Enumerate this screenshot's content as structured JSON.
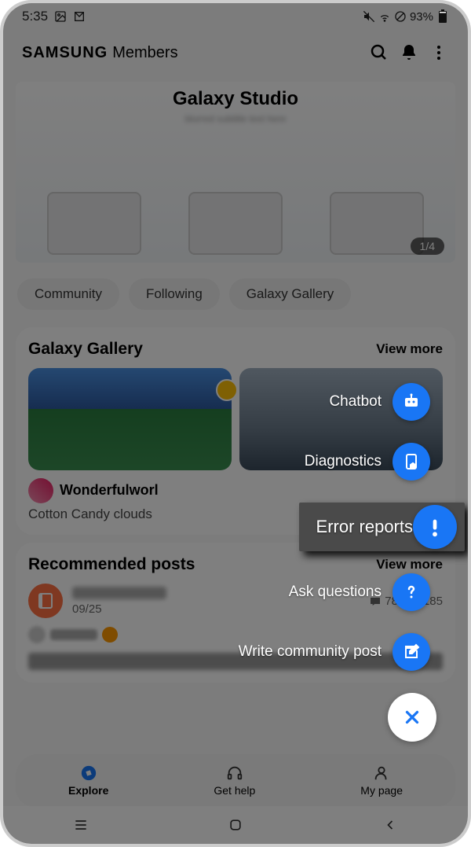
{
  "status": {
    "time": "5:35",
    "battery": "93%"
  },
  "header": {
    "brand": "SAMSUNG",
    "title": "Members"
  },
  "banner": {
    "title": "Galaxy Studio",
    "page": "1/4"
  },
  "chips": [
    "Community",
    "Following",
    "Galaxy Gallery"
  ],
  "gallery": {
    "title": "Galaxy Gallery",
    "more": "View more",
    "items": [
      {
        "author": "Wonderfulworl",
        "caption": "Cotton Candy clouds"
      }
    ]
  },
  "recommended": {
    "title": "Recommended posts",
    "more": "View more",
    "date": "09/25",
    "comments": "78",
    "likes": "185"
  },
  "fab": {
    "items": [
      {
        "label": "Chatbot"
      },
      {
        "label": "Diagnostics"
      },
      {
        "label": "Error reports",
        "highlighted": true
      },
      {
        "label": "Ask questions"
      },
      {
        "label": "Write community post"
      }
    ]
  },
  "bnav": [
    {
      "label": "Explore",
      "active": true
    },
    {
      "label": "Get help"
    },
    {
      "label": "My page"
    }
  ]
}
